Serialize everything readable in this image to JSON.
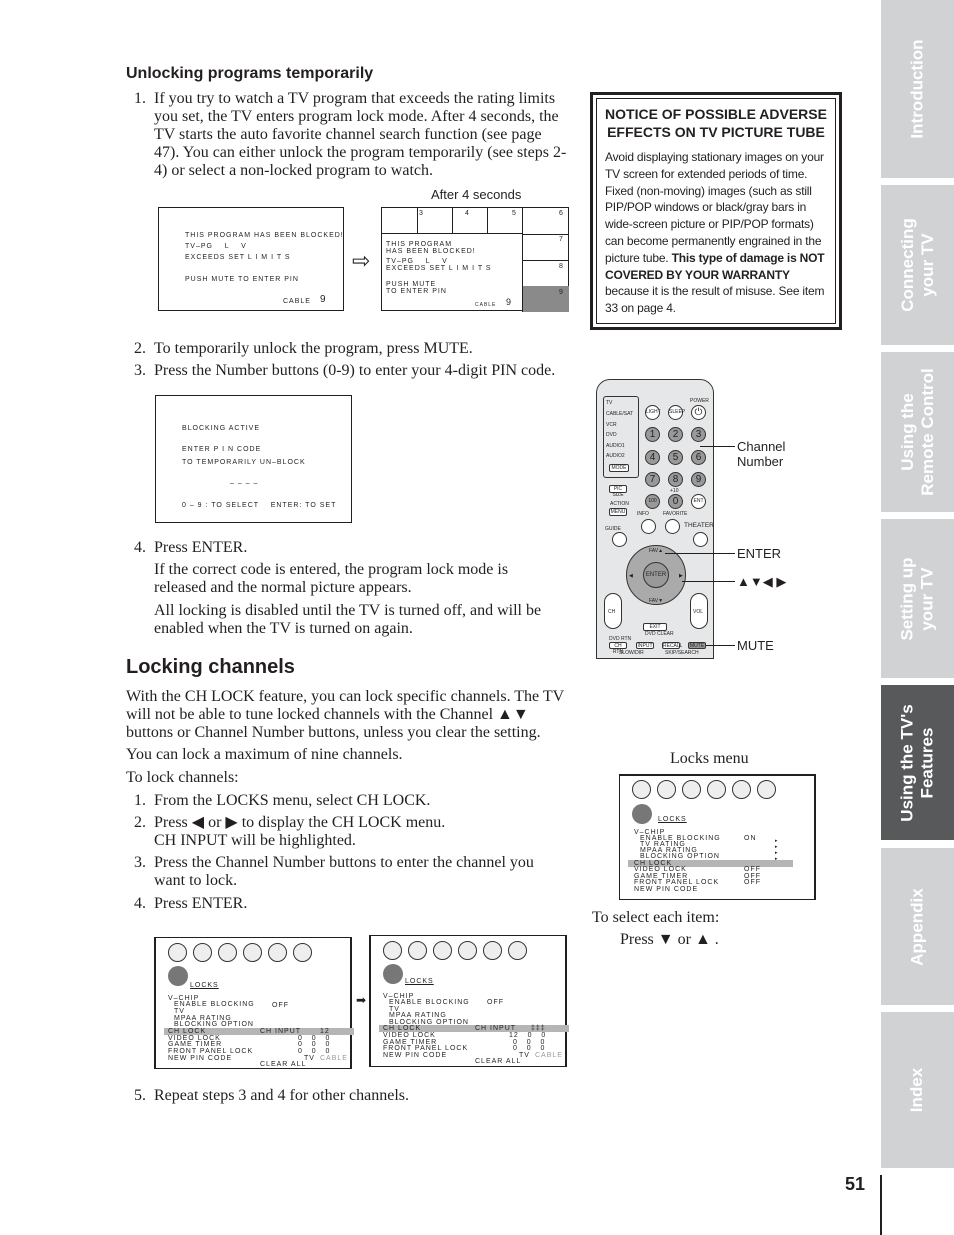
{
  "section1": {
    "heading": "Unlocking programs temporarily",
    "steps": [
      {
        "num": "1.",
        "text": "If you try to watch a TV program that exceeds the rating limits you set, the TV enters program lock mode. After 4 seconds, the TV starts the auto favorite channel search function (see page 47). You can either unlock the program temporarily (see steps 2-4) or select a non-locked program to watch."
      },
      {
        "num": "2.",
        "text": "To temporarily unlock the program, press MUTE."
      },
      {
        "num": "3.",
        "text": "Press the Number buttons (0-9) to enter your 4-digit PIN code."
      },
      {
        "num": "4.",
        "text": "Press ENTER."
      }
    ],
    "step4_p1": "If the correct code is entered, the program lock mode is released and the normal picture appears.",
    "step4_p2": "All locking is disabled until the TV is turned off, and will be enabled when the TV is turned on again.",
    "after_label": "After 4 seconds",
    "screen1": {
      "l1": "THIS PROGRAM HAS BEEN BLOCKED!",
      "l2": "TV–PG    L    V",
      "l3": "EXCEEDS SET L I M I T S",
      "l4": "PUSH MUTE TO ENTER PIN",
      "src": "CABLE",
      "ch": "9"
    },
    "screen2": {
      "l1": "THIS PROGRAM",
      "l2": "HAS BEEN BLOCKED!",
      "l3": "TV–PG    L    V",
      "l4": "EXCEEDS SET L I M I T S",
      "l5": "PUSH MUTE",
      "l6": "TO ENTER PIN",
      "src": "CABLE",
      "ch": "9",
      "thumbs": [
        "3",
        "4",
        "5",
        "6",
        "7",
        "8",
        "9"
      ]
    },
    "screen3": {
      "l1": "BLOCKING ACTIVE",
      "l2": "ENTER P I N CODE",
      "l3": "TO TEMPORARILY UN–BLOCK",
      "l4": "– – – –",
      "l5": "0 – 9 : TO SELECT    ENTER: TO SET"
    }
  },
  "notice": {
    "title": "NOTICE OF POSSIBLE ADVERSE EFFECTS ON TV PICTURE TUBE",
    "body1": "Avoid displaying stationary images on your TV screen for extended periods of time. Fixed (non-moving) images (such as still PIP/POP windows or black/gray bars in wide-screen picture or PIP/POP formats) can become permanently engrained in the picture tube. ",
    "bold": "This type of damage is NOT COVERED BY YOUR WARRANTY",
    "body2": " because it is the result of misuse. See item 33 on page 4."
  },
  "remote": {
    "modes": [
      "TV",
      "CABLE/SAT",
      "VCR",
      "DVD",
      "AUDIO1",
      "AUDIO2"
    ],
    "mode": "MODE",
    "light": "LIGHT",
    "sleep": "SLEEP",
    "power": "POWER",
    "nums": [
      "1",
      "2",
      "3",
      "4",
      "5",
      "6",
      "7",
      "8",
      "9"
    ],
    "zero": "0",
    "hundred": "100",
    "ent": "ENT",
    "plus10": "+10",
    "picsize": "PIC SIZE",
    "action": "ACTION",
    "menu": "MENU",
    "info": "INFO",
    "favorite": "FAVORITE",
    "guide": "GUIDE",
    "theater": "THEATER",
    "enter": "ENTER",
    "fav_up": "FAV▲",
    "fav_down": "FAV▼",
    "ch": "CH",
    "vol": "VOL",
    "exit": "EXIT",
    "dvdclear": "DVD CLEAR",
    "dvdrtn": "DVD RTN",
    "chrtn": "CH RTN",
    "input": "INPUT",
    "recall": "RECALL",
    "mute": "MUTE",
    "slowdir": "SLOW/DIR",
    "skipsearch": "SKIP/SEARCH",
    "callouts": {
      "channel": "Channel\nNumber",
      "enter": "ENTER",
      "arrows": "▲▼◀ ▶",
      "mute": "MUTE"
    }
  },
  "section2": {
    "heading": "Locking channels",
    "p1": "With the CH LOCK feature, you can lock specific channels. The TV will not be able to tune locked channels with the Channel ▲▼ buttons or Channel Number buttons, unless you clear the setting.",
    "p2": "You can lock a maximum of nine channels.",
    "p3": "To lock channels:",
    "steps": [
      {
        "num": "1.",
        "text": "From the LOCKS menu, select CH LOCK."
      },
      {
        "num": "2.",
        "text": "Press ◀ or ▶ to display the CH LOCK menu. CH INPUT will be highlighted."
      },
      {
        "num": "3.",
        "text": "Press the Channel Number buttons to enter the channel you want to lock."
      },
      {
        "num": "4.",
        "text": "Press ENTER."
      },
      {
        "num": "5.",
        "text": "Repeat steps 3 and 4 for other channels."
      }
    ],
    "locks_menu_label": "Locks menu",
    "select_label": "To select each item:",
    "press_label": "Press ▼ or ▲ ."
  },
  "locks_menu": {
    "title": "LOCKS",
    "vchip": "V–CHIP",
    "enable": "ENABLE BLOCKING",
    "enable_val": "ON",
    "tv": "TV RATING",
    "mpaa": "MPAA RATING",
    "blocking": "BLOCKING OPTION",
    "chlock": "CH LOCK",
    "video": "VIDEO LOCK",
    "video_val": "OFF",
    "game": "GAME TIMER",
    "game_val": "OFF",
    "front": "FRONT PANEL LOCK",
    "front_val": "OFF",
    "pin": "NEW PIN CODE"
  },
  "chlock_menu1": {
    "title": "LOCKS",
    "vchip": "V–CHIP",
    "enable": "ENABLE BLOCKING",
    "enable_val": "OFF",
    "tv": "TV",
    "mpaa": "MPAA RATING",
    "blocking": "BLOCKING OPTION",
    "chlock": "CH LOCK",
    "chinput": "CH INPUT",
    "chinput_val": "12",
    "video": "VIDEO LOCK",
    "game": "GAME TIMER",
    "front": "FRONT PANEL LOCK",
    "pin": "NEW PIN CODE",
    "rows": [
      "0   0   0",
      "0   0   0",
      "0   0   0"
    ],
    "cable": "CABLE",
    "clear": "CLEAR ALL"
  },
  "chlock_menu2": {
    "title": "LOCKS",
    "vchip": "V–CHIP",
    "enable": "ENABLE BLOCKING",
    "enable_val": "OFF",
    "tv": "TV",
    "mpaa": "MPAA RATING",
    "blocking": "BLOCKING OPTION",
    "chlock": "CH LOCK",
    "chinput": "CH INPUT",
    "chinput_val": "‡‡‡",
    "video": "VIDEO LOCK",
    "game": "GAME TIMER",
    "front": "FRONT PANEL LOCK",
    "pin": "NEW PIN CODE",
    "rows": [
      "12   0   0",
      "0   0   0",
      "0   0   0"
    ],
    "cable": "CABLE",
    "clear": "CLEAR ALL"
  },
  "tabs": [
    {
      "label": "Introduction"
    },
    {
      "label": "Connecting\nyour TV"
    },
    {
      "label": "Using the\nRemote Control"
    },
    {
      "label": "Setting up\nyour TV"
    },
    {
      "label": "Using the TV's\nFeatures",
      "active": true
    },
    {
      "label": "Appendix"
    },
    {
      "label": "Index"
    }
  ],
  "page_number": "51"
}
